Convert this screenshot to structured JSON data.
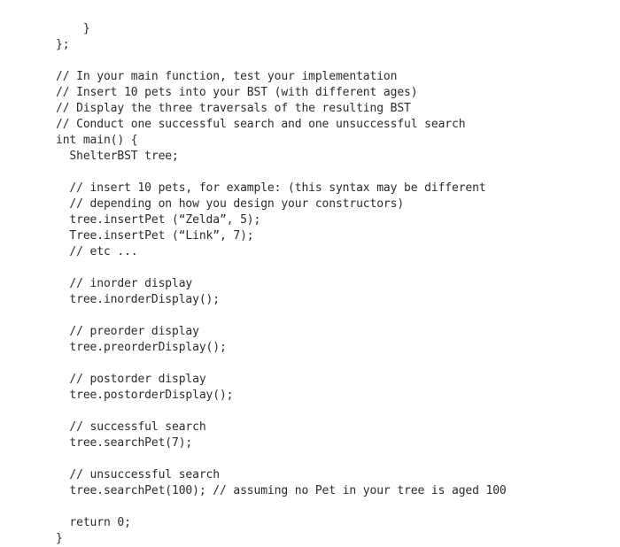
{
  "document": {
    "type": "code-listing",
    "language": "cpp",
    "background_color": "#ffffff",
    "text_color": "#2b2b2b",
    "font_size_px": 13,
    "line_height_px": 18,
    "lines": [
      "    }",
      "};",
      "",
      "// In your main function, test your implementation",
      "// Insert 10 pets into your BST (with different ages)",
      "// Display the three traversals of the resulting BST",
      "// Conduct one successful search and one unsuccessful search",
      "int main() {",
      "  ShelterBST tree;",
      "",
      "  // insert 10 pets, for example: (this syntax may be different",
      "  // depending on how you design your constructors)",
      "  tree.insertPet (“Zelda”, 5);",
      "  Tree.insertPet (“Link”, 7);",
      "  // etc ...",
      "",
      "  // inorder display",
      "  tree.inorderDisplay();",
      "",
      "  // preorder display",
      "  tree.preorderDisplay();",
      "",
      "  // postorder display",
      "  tree.postorderDisplay();",
      "",
      "  // successful search",
      "  tree.searchPet(7);",
      "",
      "  // unsuccessful search",
      "  tree.searchPet(100); // assuming no Pet in your tree is aged 100",
      "",
      "  return 0;",
      "}"
    ]
  }
}
